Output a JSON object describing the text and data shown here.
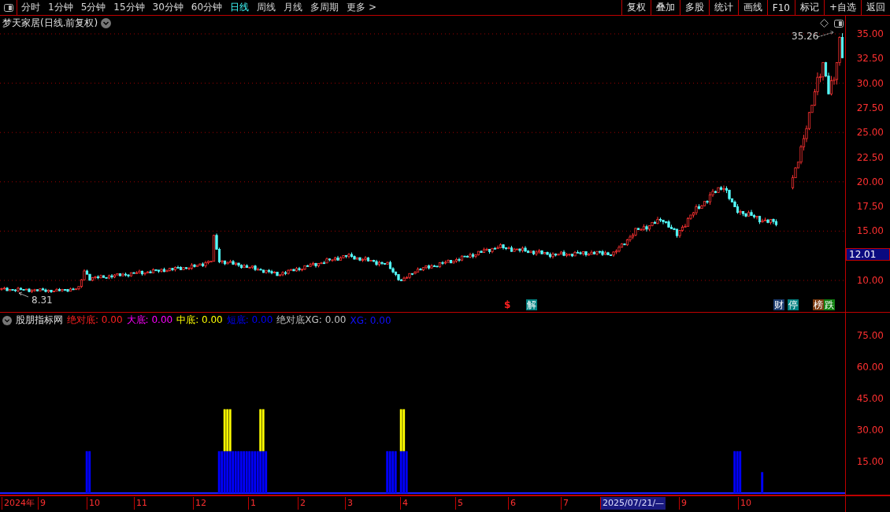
{
  "toolbar": {
    "periods": [
      {
        "label": "分时",
        "selected": false
      },
      {
        "label": "1分钟",
        "selected": false
      },
      {
        "label": "5分钟",
        "selected": false
      },
      {
        "label": "15分钟",
        "selected": false
      },
      {
        "label": "30分钟",
        "selected": false
      },
      {
        "label": "60分钟",
        "selected": false
      },
      {
        "label": "日线",
        "selected": true
      },
      {
        "label": "周线",
        "selected": false
      },
      {
        "label": "月线",
        "selected": false
      },
      {
        "label": "多周期",
        "selected": false
      }
    ],
    "more": "更多 >",
    "actions": [
      "复权",
      "叠加",
      "多股",
      "统计",
      "画线",
      "F10",
      "标记",
      "+自选",
      "返回"
    ]
  },
  "price_pane": {
    "title": "梦天家居(日线.前复权)",
    "axis": [
      "35.00",
      "32.50",
      "30.00",
      "27.50",
      "25.00",
      "22.50",
      "20.00",
      "17.50",
      "15.00",
      "10.00"
    ],
    "current_price": "12.01",
    "low_label": "8.31",
    "high_label": "35.26",
    "events": [
      {
        "text": "$",
        "kind": "sign",
        "color": "#ff2020"
      },
      {
        "text": "解",
        "kind": "tag",
        "color": "#008080"
      },
      {
        "text": "财",
        "kind": "tag",
        "color": "#1a3a6e"
      },
      {
        "text": "停",
        "kind": "tag",
        "color": "#008080"
      },
      {
        "text": "榜",
        "kind": "tag",
        "color": "#7a3a10"
      },
      {
        "text": "跌",
        "kind": "tag",
        "color": "#108010"
      }
    ]
  },
  "indicator_pane": {
    "name": "股朋指标网",
    "legend": [
      {
        "text": "绝对底: 0.00",
        "color": "#ff2020"
      },
      {
        "text": "大底: 0.00",
        "color": "#ff00ff"
      },
      {
        "text": "中底: 0.00",
        "color": "#ffff00"
      },
      {
        "text": "短底: 0.00",
        "color": "#0000ff"
      },
      {
        "text": "绝对底XG: 0.00",
        "color": "#c0c0c0"
      },
      {
        "text": "XG: 0.00",
        "color": "#1010ff"
      }
    ],
    "axis": [
      "75.00",
      "60.00",
      "45.00",
      "30.00",
      "15.00"
    ]
  },
  "time_axis": [
    {
      "label": "2024年",
      "selected": false
    },
    {
      "label": "9",
      "selected": false
    },
    {
      "label": "10",
      "selected": false
    },
    {
      "label": "11",
      "selected": false
    },
    {
      "label": "12",
      "selected": false
    },
    {
      "label": "1",
      "selected": false
    },
    {
      "label": "2",
      "selected": false
    },
    {
      "label": "3",
      "selected": false
    },
    {
      "label": "4",
      "selected": false
    },
    {
      "label": "5",
      "selected": false
    },
    {
      "label": "6",
      "selected": false
    },
    {
      "label": "7",
      "selected": false
    },
    {
      "label": "2025/07/21/—",
      "selected": true
    },
    {
      "label": "9",
      "selected": false
    },
    {
      "label": "10",
      "selected": false
    }
  ]
}
